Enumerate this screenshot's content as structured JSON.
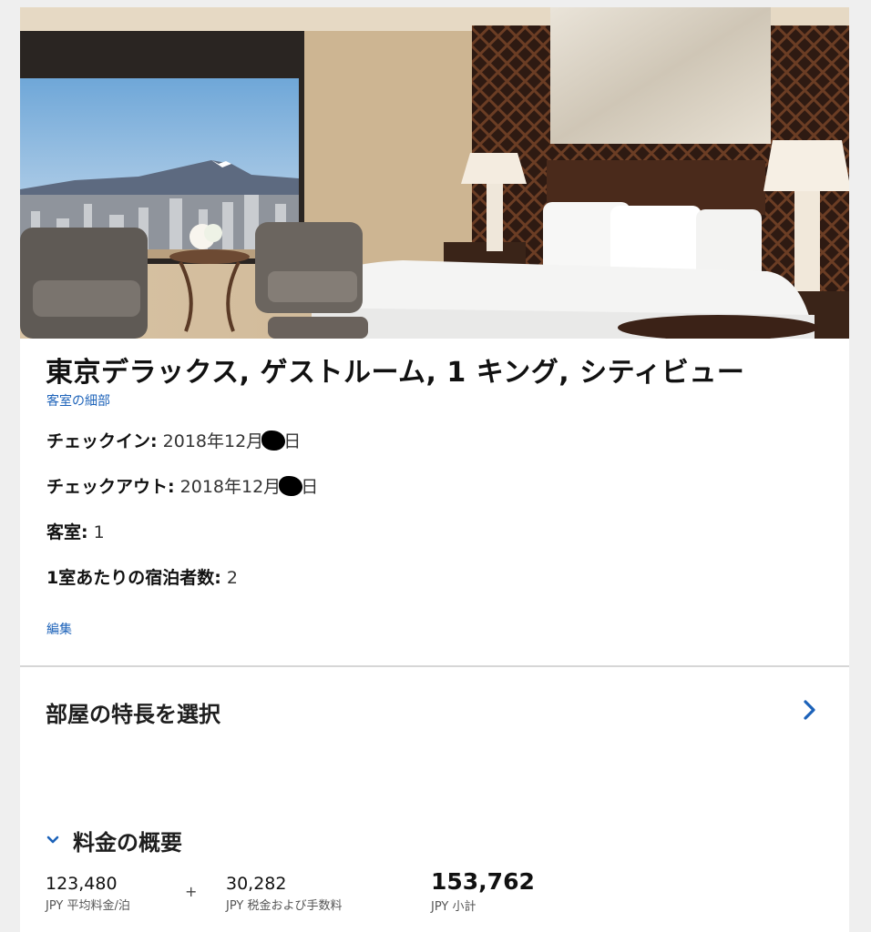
{
  "room": {
    "title": "東京デラックス, ゲストルーム, 1 キング, シティビュー",
    "details_link": "客室の細部"
  },
  "stay": {
    "checkin_label": "チェックイン:",
    "checkin_prefix": "2018年12月",
    "checkin_suffix": "日",
    "checkout_label": "チェックアウト:",
    "checkout_prefix": "2018年12月",
    "checkout_suffix": "日",
    "rooms_label": "客室:",
    "rooms_value": "1",
    "guests_label": "1室あたりの宿泊者数:",
    "guests_value": "2",
    "edit_link": "編集"
  },
  "features": {
    "heading": "部屋の特長を選択"
  },
  "summary": {
    "heading": "料金の概要",
    "avg_rate": {
      "value": "123,480",
      "caption": "JPY 平均料金/泊"
    },
    "plus": "+",
    "taxes": {
      "value": "30,282",
      "caption": "JPY 税金および手数料"
    },
    "subtotal": {
      "value": "153,762",
      "caption": "JPY 小計"
    }
  },
  "colors": {
    "link": "#1c62b9",
    "divider": "#d6d6d6",
    "text": "#111111"
  },
  "icons": {
    "features_chevron": "chevron-right-icon",
    "summary_chevron": "chevron-down-icon"
  }
}
